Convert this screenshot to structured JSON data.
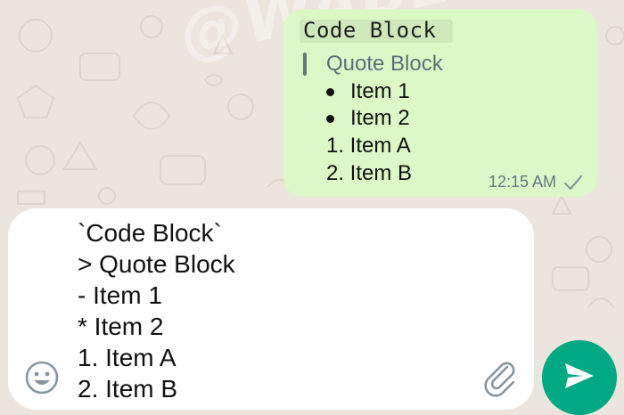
{
  "watermark": "@WABETAINFO",
  "outgoing_message": {
    "code": "Code Block",
    "quote": "Quote Block",
    "bullets": [
      "Item 1",
      "Item 2"
    ],
    "numbered": [
      "1. Item A",
      "2. Item B"
    ],
    "time": "12:15 AM",
    "status_icon": "single-check-icon"
  },
  "composer": {
    "text": "`Code Block`\n> Quote Block\n- Item 1\n* Item 2\n1. Item A\n2. Item B",
    "emoji_icon": "smiley-icon",
    "attach_icon": "paperclip-icon"
  },
  "send_button": {
    "icon": "send-arrow-icon"
  },
  "colors": {
    "background": "#ece5dd",
    "outgoing_bubble": "#dcf8c6",
    "send_button": "#00a884",
    "meta_text": "#667781"
  }
}
